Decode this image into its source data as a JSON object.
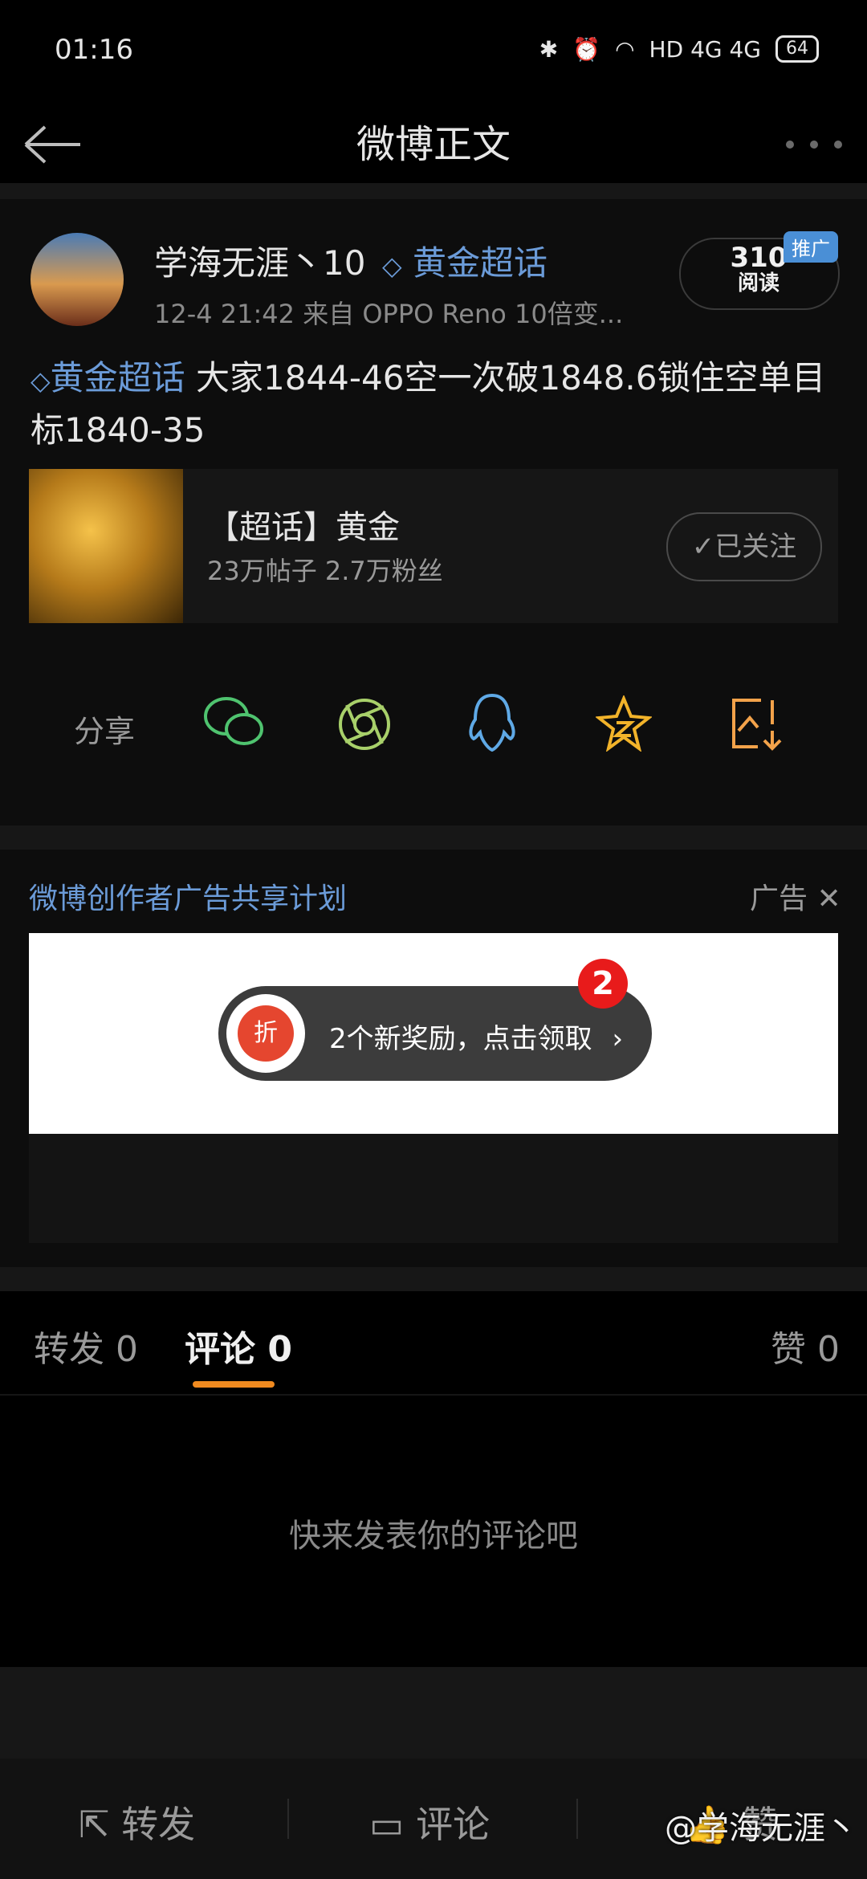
{
  "status_bar": {
    "time": "01:16",
    "indicators": "HD 4G 4G",
    "battery": "64"
  },
  "nav": {
    "title": "微博正文",
    "back_icon": "back-arrow-icon",
    "more_icon": "more-dots-icon"
  },
  "post": {
    "username": "学海无涯丶10",
    "topic_tag": "黄金超话",
    "meta": "12-4 21:42  来自 OPPO Reno 10倍变...",
    "read_count": "310",
    "read_label": "阅读",
    "promo_badge": "推广",
    "text_tag": "黄金超话",
    "text_body": " 大家1844-46空一次破1848.6锁住空单目标1840-35"
  },
  "topic_card": {
    "title": "【超话】黄金",
    "subtitle": "23万帖子 2.7万粉丝",
    "follow_label": "已关注"
  },
  "share": {
    "label": "分享",
    "icons": [
      "wechat-icon",
      "moments-icon",
      "qq-icon",
      "qzone-icon",
      "save-image-icon"
    ]
  },
  "ad": {
    "program_label": "微博创作者广告共享计划",
    "ad_label": "广告",
    "banner_text": "2个新奖励，点击领取",
    "badge_count": "2",
    "discount_char": "折"
  },
  "tabs": {
    "repost": "转发 0",
    "comment": "评论 0",
    "like": "赞 0"
  },
  "comments": {
    "empty_message": "快来发表你的评论吧"
  },
  "bottom_bar": {
    "repost": "转发",
    "comment": "评论",
    "like": "赞"
  },
  "watermark": "@学海无涯丶"
}
